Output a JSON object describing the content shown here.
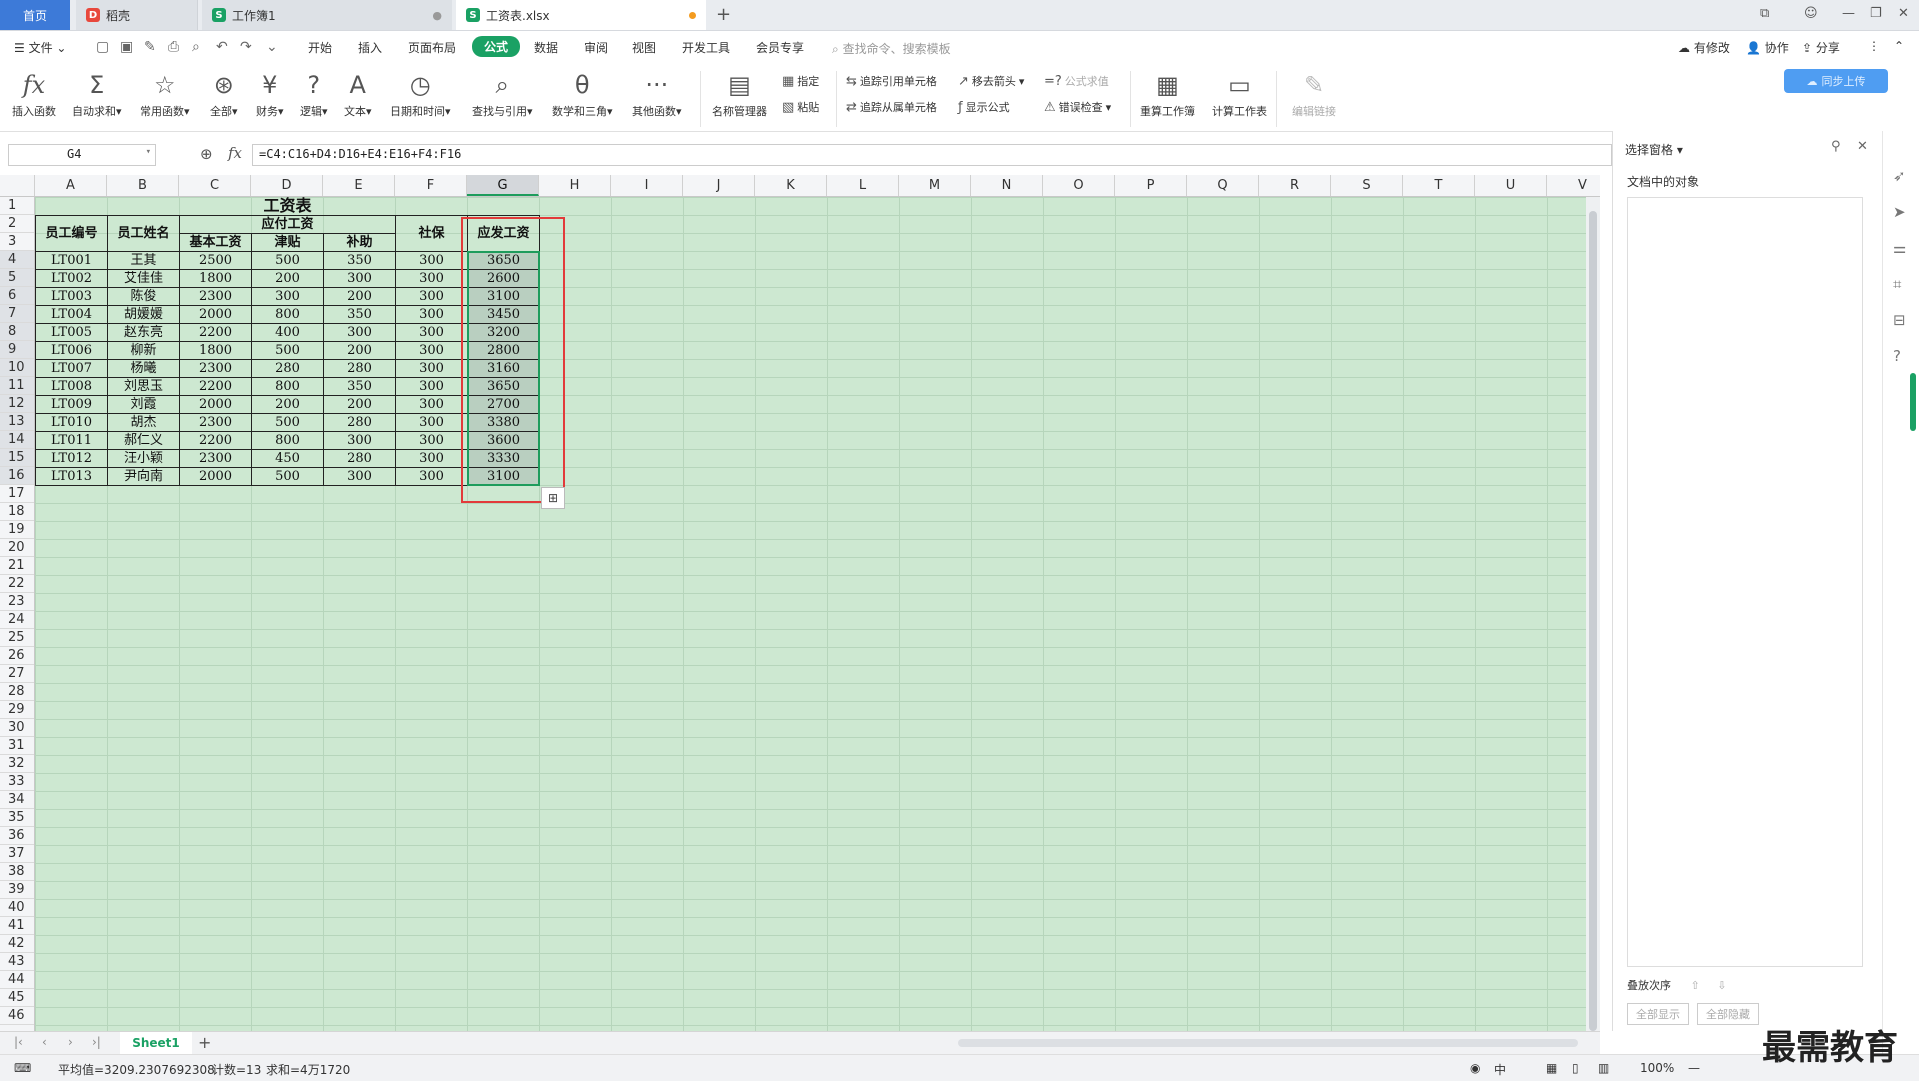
{
  "tabs": {
    "home": "首页",
    "t1": "稻壳",
    "t2": "工作簿1",
    "t3": "工资表.xlsx"
  },
  "menu": {
    "file": "文件",
    "items": [
      "开始",
      "插入",
      "页面布局",
      "公式",
      "数据",
      "审阅",
      "视图",
      "开发工具",
      "会员专享"
    ],
    "active": "公式",
    "search": "查找命令、搜索模板",
    "right": [
      "有修改",
      "协作",
      "分享"
    ]
  },
  "ribbon": {
    "big": [
      "插入函数",
      "自动求和",
      "常用函数",
      "全部",
      "财务",
      "逻辑",
      "文本",
      "日期和时间",
      "查找与引用",
      "数学和三角",
      "其他函数",
      "名称管理器"
    ],
    "small": [
      "指定",
      "粘贴",
      "追踪引用单元格",
      "追踪从属单元格",
      "移去箭头",
      "显示公式",
      "公式求值",
      "错误检查"
    ],
    "big2": [
      "重算工作簿",
      "计算工作表",
      "编辑链接"
    ],
    "cloud": "同步上传"
  },
  "formula": {
    "namebox": "G4",
    "fx": "fx",
    "content": "=C4:C16+D4:D16+E4:E16+F4:F16"
  },
  "columns": [
    "A",
    "B",
    "C",
    "D",
    "E",
    "F",
    "G",
    "H",
    "I",
    "J",
    "K",
    "L",
    "M",
    "N",
    "O",
    "P",
    "Q",
    "R",
    "S",
    "T",
    "U",
    "V"
  ],
  "table": {
    "title": "工资表",
    "h_id": "员工编号",
    "h_name": "员工姓名",
    "h_pay": "应付工资",
    "h_base": "基本工资",
    "h_allow": "津贴",
    "h_subsidy": "补助",
    "h_social": "社保",
    "h_total": "应发工资",
    "rows": [
      [
        "LT001",
        "王其",
        "2500",
        "500",
        "350",
        "300",
        "3650"
      ],
      [
        "LT002",
        "艾佳佳",
        "1800",
        "200",
        "300",
        "300",
        "2600"
      ],
      [
        "LT003",
        "陈俊",
        "2300",
        "300",
        "200",
        "300",
        "3100"
      ],
      [
        "LT004",
        "胡媛媛",
        "2000",
        "800",
        "350",
        "300",
        "3450"
      ],
      [
        "LT005",
        "赵东亮",
        "2200",
        "400",
        "300",
        "300",
        "3200"
      ],
      [
        "LT006",
        "柳新",
        "1800",
        "500",
        "200",
        "300",
        "2800"
      ],
      [
        "LT007",
        "杨曦",
        "2300",
        "280",
        "280",
        "300",
        "3160"
      ],
      [
        "LT008",
        "刘思玉",
        "2200",
        "800",
        "350",
        "300",
        "3650"
      ],
      [
        "LT009",
        "刘霞",
        "2000",
        "200",
        "200",
        "300",
        "2700"
      ],
      [
        "LT010",
        "胡杰",
        "2300",
        "500",
        "280",
        "300",
        "3380"
      ],
      [
        "LT011",
        "郝仁义",
        "2200",
        "800",
        "300",
        "300",
        "3600"
      ],
      [
        "LT012",
        "汪小颖",
        "2300",
        "450",
        "280",
        "300",
        "3330"
      ],
      [
        "LT013",
        "尹向南",
        "2000",
        "500",
        "300",
        "300",
        "3100"
      ]
    ]
  },
  "sheet": {
    "tab": "Sheet1"
  },
  "status": {
    "avg": "平均值=3209.2307692308",
    "count": "计数=13",
    "sum": "求和=4万1720",
    "zoom": "100%",
    "ime": "中"
  },
  "pane": {
    "title": "选择窗格",
    "sub": "文档中的对象",
    "stack": "叠放次序",
    "showall": "全部显示",
    "hideall": "全部隐藏"
  },
  "watermark": "最需教育"
}
